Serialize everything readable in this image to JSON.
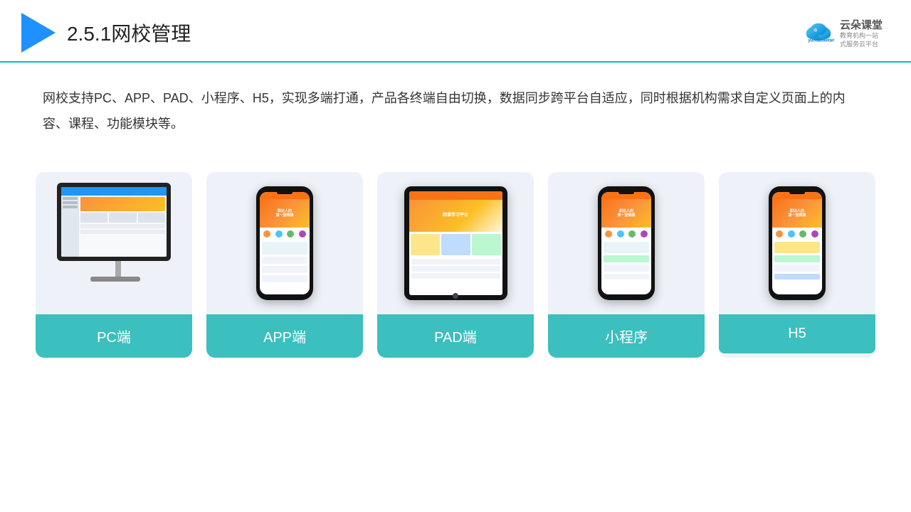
{
  "header": {
    "title_prefix": "2.5.1",
    "title_main": "网校管理",
    "logo_name": "云朵课堂",
    "logo_url": "yunduoketang.com",
    "logo_sub_line1": "教育机构一站",
    "logo_sub_line2": "式服务云平台"
  },
  "description": {
    "text": "网校支持PC、APP、PAD、小程序、H5，实现多端打通，产品各终端自由切换，数据同步跨平台自适应，同时根据机构需求自定义页面上的内容、课程、功能模块等。"
  },
  "cards": [
    {
      "id": "pc",
      "label": "PC端"
    },
    {
      "id": "app",
      "label": "APP端"
    },
    {
      "id": "pad",
      "label": "PAD端"
    },
    {
      "id": "miniprogram",
      "label": "小程序"
    },
    {
      "id": "h5",
      "label": "H5"
    }
  ],
  "colors": {
    "accent": "#00bcd4",
    "card_label_bg": "#3bbfbf",
    "card_bg": "#eef2f8",
    "header_border": "#00bcd4",
    "play_icon": "#1e90ff"
  }
}
